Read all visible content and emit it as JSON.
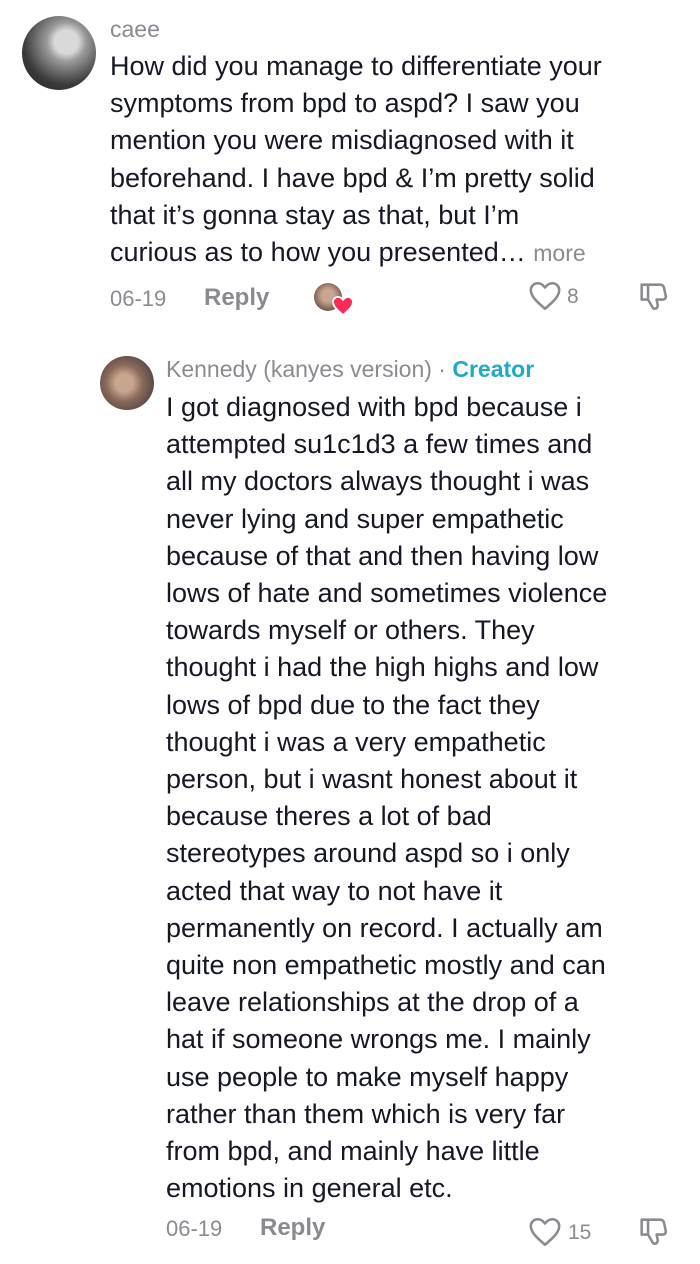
{
  "comment": {
    "username": "caee",
    "lines": [
      "How did you manage to differentiate your",
      "symptoms from bpd to aspd? I saw you",
      "mention you were misdiagnosed with it",
      "beforehand. I have bpd & I’m pretty solid",
      "that it’s gonna stay as that, but I’m",
      "curious as to how you presented…"
    ],
    "more_label": "more",
    "date": "06-19",
    "reply_label": "Reply",
    "like_count": "8"
  },
  "reply": {
    "username": "Kennedy (kanyes version)",
    "separator": " · ",
    "badge": "Creator",
    "lines": [
      "I got diagnosed with bpd because i",
      "attempted su1c1d3 a few times and",
      "all my doctors always thought i was",
      "never lying and super empathetic",
      "because of that and then having low",
      "lows of hate and sometimes violence",
      "towards myself or others. They",
      "thought i had the high highs and low",
      "lows of bpd due to the fact they",
      "thought i was a very empathetic",
      "person, but i wasnt honest about it",
      "because theres a lot of bad",
      "stereotypes around aspd so i only",
      "acted that way to not have it",
      "permanently on record. I actually am",
      "quite non empathetic mostly and can",
      "leave relationships at the drop of a",
      "hat if someone wrongs me. I mainly",
      "use people to make myself happy",
      "rather than them which is very far",
      "from bpd, and mainly have little",
      "emotions in general etc."
    ],
    "date": "06-19",
    "reply_label": "Reply",
    "like_count": "15"
  },
  "colors": {
    "text": "#161823",
    "muted": "#8a8b91",
    "creator": "#21a9c7",
    "heart": "#fe2c55"
  }
}
